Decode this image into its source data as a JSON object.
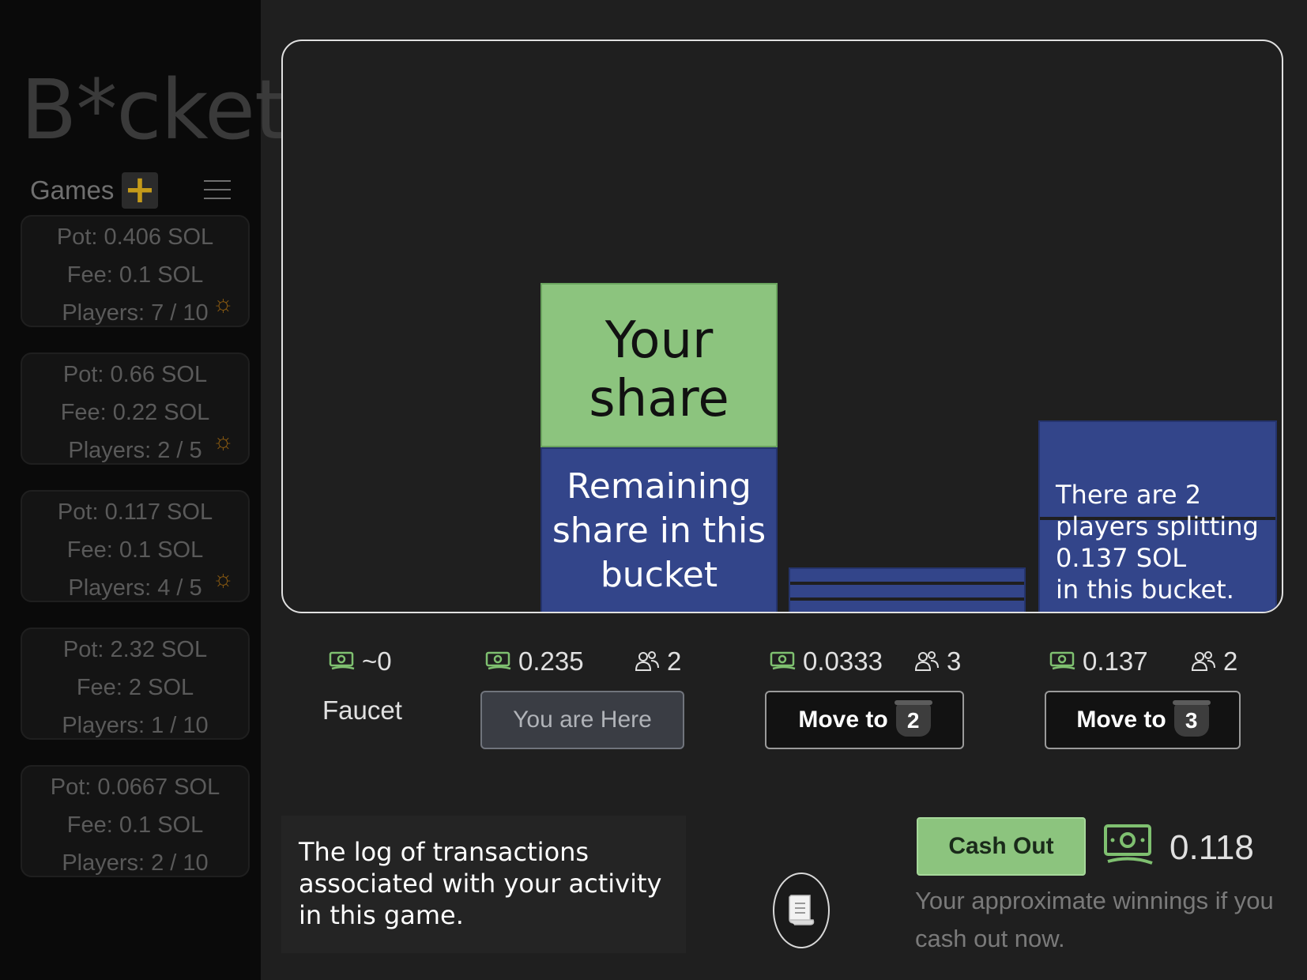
{
  "app": {
    "logo": "B*cket"
  },
  "sidebar": {
    "games_label": "Games",
    "add_symbol": "+",
    "games": [
      {
        "pot": "Pot: 0.406 SOL",
        "fee": "Fee: 0.1 SOL",
        "players": "Players: 7 / 10",
        "active": true
      },
      {
        "pot": "Pot: 0.66 SOL",
        "fee": "Fee: 0.22 SOL",
        "players": "Players: 2 / 5",
        "active": true
      },
      {
        "pot": "Pot: 0.117 SOL",
        "fee": "Fee: 0.1 SOL",
        "players": "Players: 4 / 5",
        "active": true
      },
      {
        "pot": "Pot: 2.32 SOL",
        "fee": "Fee: 2 SOL",
        "players": "Players: 1 / 10",
        "active": false
      },
      {
        "pot": "Pot: 0.0667 SOL",
        "fee": "Fee: 0.1 SOL",
        "players": "Players: 2 / 10",
        "active": false
      }
    ],
    "active_icon": "sun-icon"
  },
  "board": {
    "your_share": "Your share",
    "remaining": "Remaining share in this bucket",
    "bucket3_note": "There are 2\nplayers splitting\n0.137 SOL\nin this bucket."
  },
  "buckets": {
    "faucet": {
      "amount": "~0",
      "label": "Faucet"
    },
    "b1": {
      "amount": "0.235",
      "players": "2",
      "button": "You are Here"
    },
    "b2": {
      "amount": "0.0333",
      "players": "3",
      "button": "Move to",
      "badge": "2"
    },
    "b3": {
      "amount": "0.137",
      "players": "2",
      "button": "Move to",
      "badge": "3"
    }
  },
  "log": {
    "text": "The log of transactions associated with your activity in this game."
  },
  "cashout": {
    "button": "Cash Out",
    "amount": "0.118",
    "note": "Your approximate winnings if you cash out now."
  },
  "colors": {
    "green": "#8cc47e",
    "blue": "#33458a",
    "accent": "#c49a1a"
  }
}
